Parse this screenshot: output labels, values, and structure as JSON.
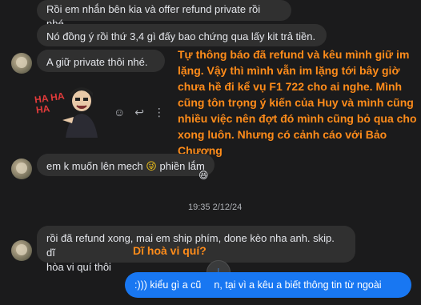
{
  "messages": {
    "m1": "Rồi em nhắn bên kia và offer refund private rồi nhé.",
    "m2": "Nó đồng ý rồi thứ 3,4 gì đấy bao chứng qua lấy kit trả tiền.",
    "m3": "A giữ private thôi nhé.",
    "m4_a": "em k muốn lên mech",
    "m4_b": "phiền lắm",
    "m5_line1": "rồi đã refund xong, mai em ship phím, done kèo nha anh. skip. dĩ",
    "m5_line2": "hòa vi quí thôi",
    "sent": ":))) kiểu gì a cũ",
    "sent_rest": "n, tại vì a kêu a biết thông tin từ ngoài"
  },
  "sticker_text": "HA HA HA",
  "timestamp": "19:35 2/12/24",
  "annotation_main": "Tự thông báo đã refund và kêu mình giữ im lặng. Vậy thì mình vẫn im lặng tới bây giờ chưa hề đi kể vụ F1 722 cho ai nghe. Mình cũng tôn trọng ý kiến của Huy và mình cũng nhiều việc nên đợt đó mình cũng bỏ qua cho xong luôn. Nhưng có cảnh cáo với Bảo Chương",
  "annotation_short": "Dĩ hoà vi quí?",
  "colors": {
    "annotation": "#ff8c1a",
    "sent_bubble": "#1877f2",
    "bubble": "#303030"
  }
}
